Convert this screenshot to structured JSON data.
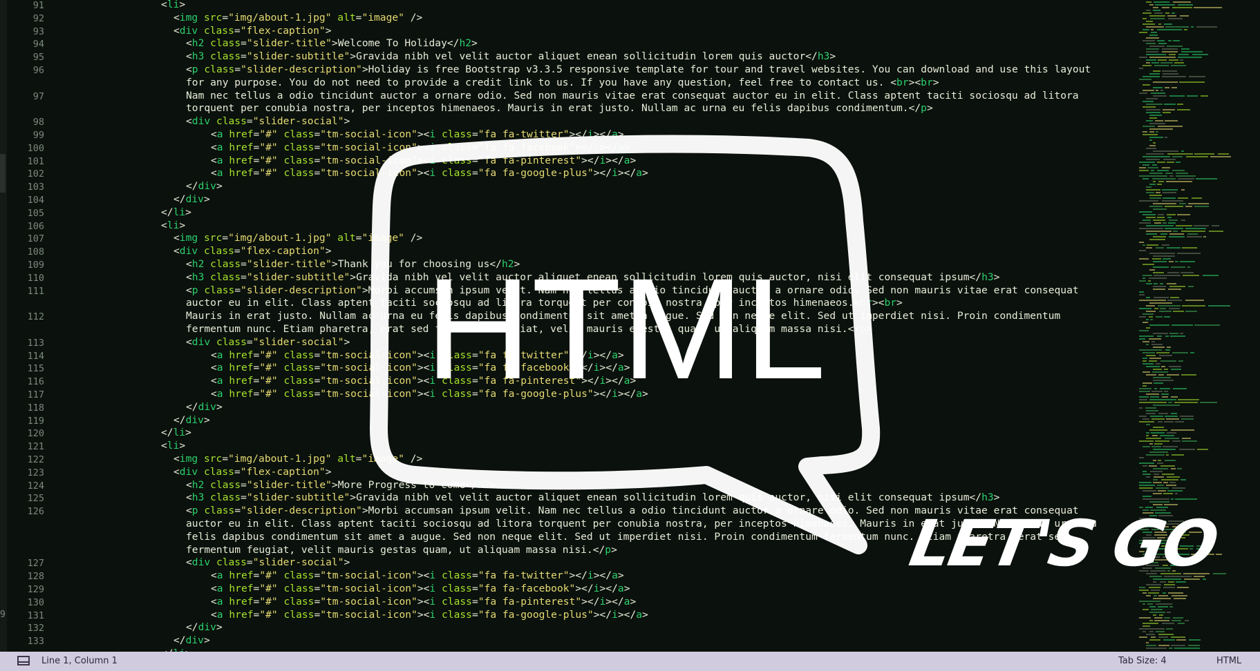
{
  "editor": {
    "line_numbers": [
      "91",
      "92",
      "93",
      "94",
      "95",
      "96",
      "97",
      "98",
      "99",
      "100",
      "101",
      "102",
      "103",
      "104",
      "105",
      "106",
      "107",
      "108",
      "109",
      "110",
      "111",
      "112",
      "113",
      "114",
      "115",
      "116",
      "117",
      "118",
      "119",
      "120",
      "121",
      "122",
      "123",
      "124",
      "125",
      "126",
      "127",
      "128",
      "129",
      "130",
      "131",
      "132",
      "133"
    ],
    "left_sliver_number": "9",
    "lines": [
      {
        "text": "<li>"
      },
      {
        "text": "<img src=\"img/about-1.jpg\" alt=\"image\" />"
      },
      {
        "text": "<div class=\"flex-caption\">"
      },
      {
        "text": "<h2 class=\"slider-title\">Welcome To Holiday</h2>"
      },
      {
        "text": "<h3 class=\"slider-subtitle\">Gravida nibh vel velit auctor aliquet enean sollicitudin lorem quis auctor</h3>"
      },
      {
        "text": "<p class=\"slider-description\">Holiday is free Bootstrap v3.3.5 responsive template for tour and travel websites. You can download and use this layout"
      },
      {
        "text": "for any purpose. You do not need to provide a credit link to us. If you have any question, feel free to contact us. <br><br>"
      },
      {
        "text": "Nam nec tellus a odio tincidunt auctor a ornare odio. Sed non mauris vitae erat consequat auctor eu in elit. Class aptent taciti sociosqu ad litora"
      },
      {
        "text": "torquent per conubia nostra, per inceptos himenaeos. Mauris in erat justo. Nullam ac urna eu felis dapibus condimentum.</p>"
      },
      {
        "text": "<div class=\"slider-social\">"
      },
      {
        "text": "<a href=\"#\" class=\"tm-social-icon\"><i class=\"fa fa-twitter\"></i></a>"
      },
      {
        "text": "<a href=\"#\" class=\"tm-social-icon\"><i class=\"fa fa-facebook\"></i></a>"
      },
      {
        "text": "<a href=\"#\" class=\"tm-social-icon\"><i class=\"fa fa-pinterest\"></i></a>"
      },
      {
        "text": "<a href=\"#\" class=\"tm-social-icon\"><i class=\"fa fa-google-plus\"></i></a>"
      },
      {
        "text": "</div>"
      },
      {
        "text": "</div>"
      },
      {
        "text": "</li>"
      },
      {
        "text": "<li>"
      },
      {
        "text": "<img src=\"img/about-1.jpg\" alt=\"image\" />"
      },
      {
        "text": "<div class=\"flex-caption\">"
      },
      {
        "text": "<h2 class=\"slider-title\">Thank you for choosing us</h2>"
      },
      {
        "text": "<h3 class=\"slider-subtitle\">Gravida nibh vel velit auctor aliquet enean sollicitudin lorem quis auctor, nisi elit consequat ipsum</h3>"
      },
      {
        "text": "<p class=\"slider-description\">Morbi accumsan ipsum velit. Nam nec tellus a odio tincidunt auctor a ornare odio. Sed non mauris vitae erat consequat"
      },
      {
        "text": "auctor eu in elit. Class aptent taciti sociosqu ad litora torquent per conubia nostra, per inceptos himenaeos.<br><br>"
      },
      {
        "text": "Mauris in erat justo. Nullam ac urna eu felis dapibus condimentum sit amet a augue. Sed non neque elit. Sed ut imperdiet nisi. Proin condimentum"
      },
      {
        "text": "fermentum nunc. Etiam pharetra, erat sed fermentum feugiat, velit mauris egestas quam, ut aliquam massa nisi.</p>"
      },
      {
        "text": "<div class=\"slider-social\">"
      },
      {
        "text": "<a href=\"#\" class=\"tm-social-icon\"><i class=\"fa fa-twitter\"></i></a>"
      },
      {
        "text": "<a href=\"#\" class=\"tm-social-icon\"><i class=\"fa fa-facebook\"></i></a>"
      },
      {
        "text": "<a href=\"#\" class=\"tm-social-icon\"><i class=\"fa fa-pinterest\"></i></a>"
      },
      {
        "text": "<a href=\"#\" class=\"tm-social-icon\"><i class=\"fa fa-google-plus\"></i></a>"
      },
      {
        "text": "</div>"
      },
      {
        "text": "</div>"
      },
      {
        "text": "</li>"
      },
      {
        "text": "<li>"
      },
      {
        "text": "<img src=\"img/about-1.jpg\" alt=\"image\" />"
      },
      {
        "text": "<div class=\"flex-caption\">"
      },
      {
        "text": "<h2 class=\"slider-title\">More Progress to come</h2>"
      },
      {
        "text": "<h3 class=\"slider-subtitle\">Gravida nibh vel velit auctor aliquet enean sollicitudin lorem quis auctor, nisi elit consequat ipsum</h3>"
      },
      {
        "text": "<p class=\"slider-description\">Morbi accumsan ipsum velit. Nam nec tellus a odio tincidunt auctor a ornare odio. Sed non mauris vitae erat consequat"
      },
      {
        "text": "auctor eu in elit. Class aptent taciti sociosqu ad litora torquent per conubia nostra, per inceptos himenaeos. Mauris in erat justo. Nullam ac urna eu"
      },
      {
        "text": "felis dapibus condimentum sit amet a augue. Sed non neque elit. Sed ut imperdiet nisi. Proin condimentum fermentum nunc. Etiam pharetra, erat sed"
      },
      {
        "text": "fermentum feugiat, velit mauris gestas quam, ut aliquam massa nisi.</p>"
      },
      {
        "text": "<div class=\"slider-social\">"
      },
      {
        "text": "<a href=\"#\" class=\"tm-social-icon\"><i class=\"fa fa-twitter\"></i></a>"
      },
      {
        "text": "<a href=\"#\" class=\"tm-social-icon\"><i class=\"fa fa-facebook\"></i></a>"
      },
      {
        "text": "<a href=\"#\" class=\"tm-social-icon\"><i class=\"fa fa-pinterest\"></i></a>"
      },
      {
        "text": "<a href=\"#\" class=\"tm-social-icon\"><i class=\"fa fa-google-plus\"></i></a>"
      },
      {
        "text": "</div>"
      },
      {
        "text": "</div>"
      },
      {
        "text": "</li>"
      }
    ],
    "colors": {
      "background": "#0b110c",
      "text": "#e8ecd9",
      "tag": "#2bd16d",
      "attribute": "#a6e22e",
      "string": "#e6db74",
      "line_number": "#7b8a7f"
    }
  },
  "overlay": {
    "logo_text": "HTML",
    "tagline": "LET'S GO"
  },
  "statusbar": {
    "panel_icon": "panel-toggle-icon",
    "cursor_position": "Line 1, Column 1",
    "tab_size": "Tab Size: 4",
    "syntax": "HTML",
    "background": "#d1cbe0"
  }
}
